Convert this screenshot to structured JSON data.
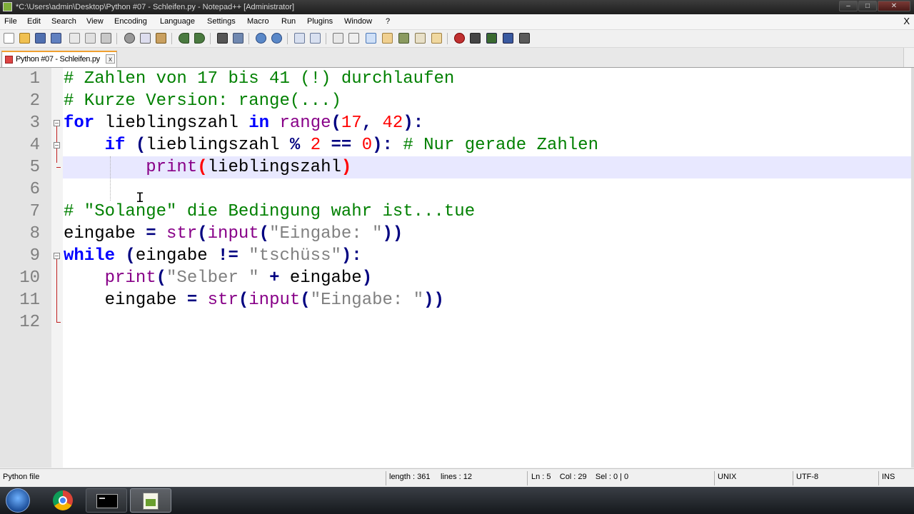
{
  "window": {
    "title": "*C:\\Users\\admin\\Desktop\\Python #07 - Schleifen.py - Notepad++ [Administrator]",
    "buttons": [
      "minimize",
      "maximize",
      "close"
    ]
  },
  "menu": {
    "items": [
      "File",
      "Edit",
      "Search",
      "View",
      "Encoding",
      "Language",
      "Settings",
      "Macro",
      "Run",
      "Plugins",
      "Window",
      "?"
    ],
    "close_label": "X"
  },
  "toolbar": {
    "icons": [
      "new-file-icon",
      "open-file-icon",
      "save-icon",
      "save-all-icon",
      "close-icon",
      "close-all-icon",
      "print-icon",
      "cut-icon",
      "copy-icon",
      "paste-icon",
      "undo-icon",
      "redo-icon",
      "find-icon",
      "replace-icon",
      "zoom-in-icon",
      "zoom-out-icon",
      "sync-vertical-icon",
      "sync-horizontal-icon",
      "word-wrap-icon",
      "show-all-chars-icon",
      "indent-guide-icon",
      "user-language-icon",
      "doc-map-icon",
      "function-list-icon",
      "folder-workspace-icon",
      "record-macro-icon",
      "stop-macro-icon",
      "play-macro-icon",
      "run-macro-multiple-icon",
      "save-macro-icon"
    ]
  },
  "tab": {
    "label": "Python #07 - Schleifen.py",
    "close_label": "x"
  },
  "editor": {
    "line_numbers": [
      "1",
      "2",
      "3",
      "4",
      "5",
      "6",
      "7",
      "8",
      "9",
      "10",
      "11",
      "12"
    ],
    "lines": [
      "# Zahlen von 17 bis 41 (!) durchlaufen",
      "# Kurze Version: range(...)",
      "for lieblingszahl in range(17, 42):",
      "    if (lieblingszahl % 2 == 0): # Nur gerade Zahlen",
      "        print(lieblingszahl)",
      "",
      "# \"Solange\" die Bedingung wahr ist...tue",
      "eingabe = str(input(\"Eingabe: \"))",
      "while (eingabe != \"tschüss\"):",
      "    print(\"Selber \" + eingabe)",
      "    eingabe = str(input(\"Eingabe: \"))",
      ""
    ],
    "current_line": 5
  },
  "statusbar": {
    "file_type": "Python file",
    "length": "length : 361",
    "lines": "lines : 12",
    "position": "Ln : 5    Col : 29    Sel : 0 | 0",
    "eol": "UNIX",
    "encoding": "UTF-8",
    "mode": "INS"
  },
  "taskbar": {
    "items": [
      "start-orb-icon",
      "chrome-icon",
      "cmd-icon",
      "notepadpp-icon"
    ]
  },
  "colors": {
    "keyword": "#0000ff",
    "builtin": "#880088",
    "comment": "#008000",
    "number": "#ff0000",
    "string": "#808080",
    "current_line": "#e8e8ff"
  }
}
